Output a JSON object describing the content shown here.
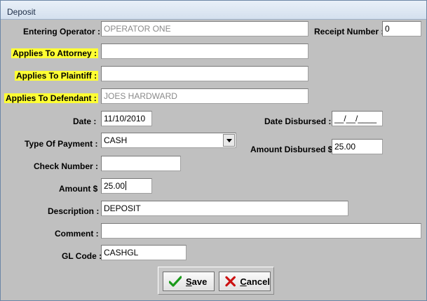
{
  "window": {
    "title": "Deposit"
  },
  "labels": {
    "entering_operator": "Entering Operator :",
    "receipt_number": "Receipt Number :",
    "applies_attorney": "Applies To Attorney :",
    "applies_plaintiff": "Applies To Plaintiff :",
    "applies_defendant": "Applies To Defendant :",
    "date": "Date :",
    "date_disbursed": "Date Disbursed :",
    "type_of_payment": "Type Of Payment :",
    "amount_disbursed": "Amount Disbursed $",
    "check_number": "Check Number :",
    "amount": "Amount $",
    "description": "Description :",
    "comment": "Comment :",
    "gl_code": "GL Code :"
  },
  "fields": {
    "entering_operator": "OPERATOR ONE",
    "receipt_number": "0",
    "applies_attorney": "",
    "applies_plaintiff": "",
    "applies_defendant": "JOES HARDWARD",
    "date": "11/10/2010",
    "date_disbursed": "__/__/____",
    "type_of_payment": "CASH",
    "amount_disbursed": "25.00",
    "check_number": "",
    "amount": "25.00",
    "description": "DEPOSIT",
    "comment": "",
    "gl_code": "CASHGL"
  },
  "buttons": {
    "save_mnemonic": "S",
    "save_rest": "ave",
    "cancel_mnemonic": "C",
    "cancel_rest": "ancel"
  },
  "colors": {
    "highlight": "#ffff33",
    "save_icon": "#1a9a1a",
    "cancel_icon": "#cc1111"
  }
}
